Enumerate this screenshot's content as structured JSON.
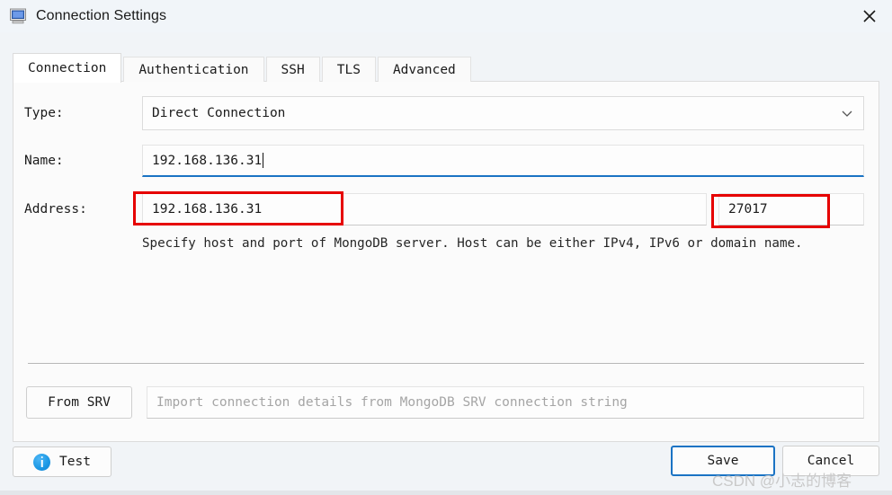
{
  "window": {
    "title": "Connection Settings",
    "icon": "monitor-icon",
    "close_label": "✕"
  },
  "tabs": [
    {
      "label": "Connection",
      "active": true
    },
    {
      "label": "Authentication",
      "active": false
    },
    {
      "label": "SSH",
      "active": false
    },
    {
      "label": "TLS",
      "active": false
    },
    {
      "label": "Advanced",
      "active": false
    }
  ],
  "form": {
    "type": {
      "label": "Type:",
      "value": "Direct Connection",
      "arrow_icon": "chevron-down-icon"
    },
    "name": {
      "label": "Name:",
      "value": "192.168.136.31"
    },
    "address": {
      "label": "Address:",
      "host_value": "192.168.136.31",
      "separator": ":",
      "port_value": "27017",
      "help_text": "Specify host and port of MongoDB server. Host can be either IPv4, IPv6 or domain name."
    }
  },
  "srv": {
    "button_label": "From SRV",
    "input_placeholder": "Import connection details from MongoDB SRV connection string"
  },
  "footer": {
    "test_label": "Test",
    "test_icon": "info-icon",
    "save_label": "Save",
    "cancel_label": "Cancel"
  },
  "annotations": {
    "host_highlight_color": "#e60000",
    "port_highlight_color": "#e60000"
  },
  "watermark": {
    "text": "CSDN @小志的博客"
  },
  "colors": {
    "accent": "#1a73c4",
    "window_bg": "#f1f4f7",
    "panel_bg": "#fbfbfb",
    "annotation_red": "#e60000"
  }
}
